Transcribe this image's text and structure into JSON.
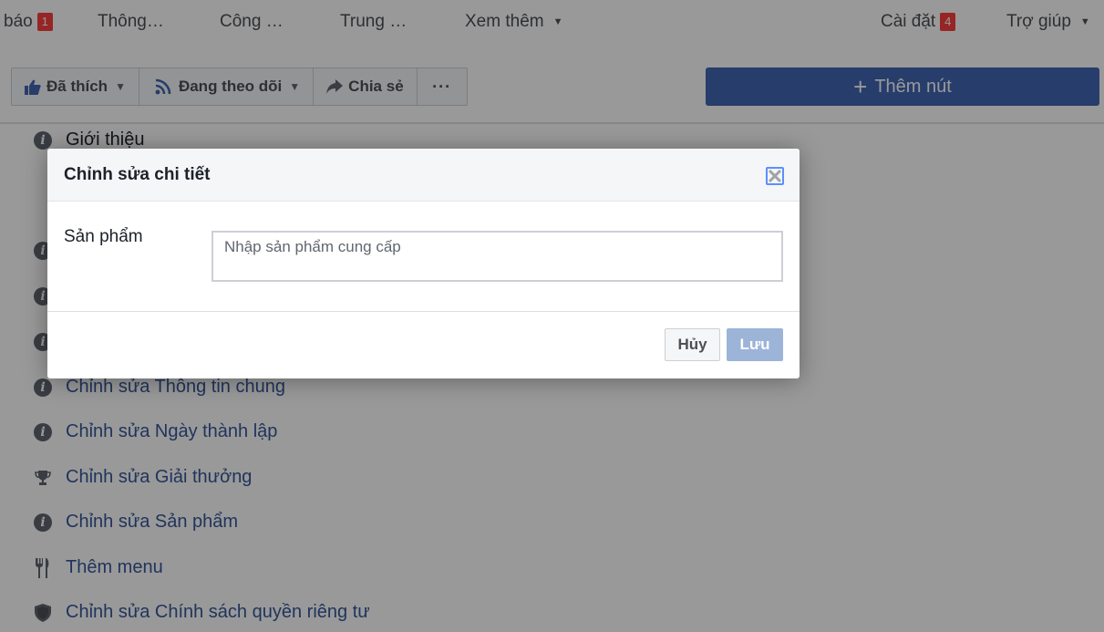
{
  "topnav": {
    "items": [
      {
        "label": "báo",
        "badge": "1"
      },
      {
        "label": "Thông…"
      },
      {
        "label": "Công …"
      },
      {
        "label": "Trung …"
      },
      {
        "label": "Xem thêm",
        "caret": "▼"
      }
    ],
    "right_items": [
      {
        "label": "Cài đặt",
        "badge": "4"
      },
      {
        "label": "Trợ giúp",
        "caret": "▼"
      }
    ]
  },
  "actionbar": {
    "liked_label": "Đã thích",
    "following_label": "Đang theo dõi",
    "share_label": "Chia sẻ",
    "more_label": "···",
    "dropdown_caret": "▼"
  },
  "add_button": {
    "plus": "+",
    "label": "Thêm nút"
  },
  "sidebar_list": {
    "heading": {
      "label": "Giới thiệu",
      "icon": "info-icon"
    },
    "items": [
      {
        "label": "Chỉnh sửa Thông tin chung",
        "icon": "info-icon"
      },
      {
        "label": "Chỉnh sửa Ngày thành lập",
        "icon": "info-icon"
      },
      {
        "label": "Chỉnh sửa Giải thưởng",
        "icon": "trophy-icon"
      },
      {
        "label": "Chỉnh sửa Sản phẩm",
        "icon": "info-icon"
      },
      {
        "label": "Thêm menu",
        "icon": "fork-knife-icon"
      },
      {
        "label": "Chỉnh sửa Chính sách quyền riêng tư",
        "icon": "shield-icon"
      }
    ]
  },
  "modal": {
    "title": "Chỉnh sửa chi tiết",
    "field_label": "Sản phẩm",
    "field_value": "",
    "field_placeholder": "Nhập sản phẩm cung cấp",
    "cancel_label": "Hủy",
    "save_label": "Lưu"
  },
  "colors": {
    "brand_blue": "#4267b2",
    "link_blue": "#365899",
    "badge_red": "#fa3e3e",
    "save_disabled": "#9cb4d8"
  }
}
